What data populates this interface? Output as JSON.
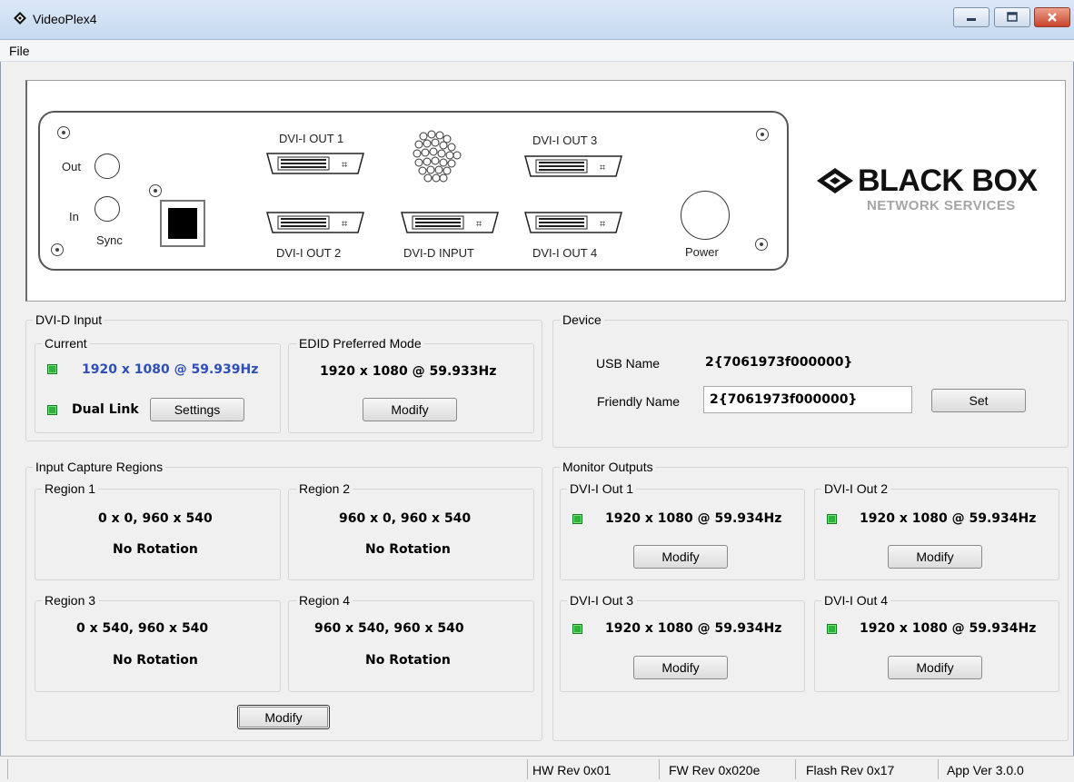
{
  "window": {
    "title": "VideoPlex4",
    "minimize_icon": "minimize-icon",
    "maximize_icon": "maximize-icon",
    "close_icon": "close-icon"
  },
  "menu": {
    "file": "File"
  },
  "device_panel": {
    "out_label": "Out",
    "in_label": "In",
    "sync_label": "Sync",
    "dvi_out1": "DVI-I OUT 1",
    "dvi_out2": "DVI-I OUT 2",
    "dvi_out3": "DVI-I OUT 3",
    "dvi_out4": "DVI-I OUT 4",
    "dvi_input": "DVI-D INPUT",
    "power": "Power",
    "logo_main": "BLACK BOX",
    "logo_sub": "NETWORK SERVICES"
  },
  "dvi_input_group": {
    "title": "DVI-D Input",
    "current": {
      "title": "Current",
      "resolution": "1920 x 1080 @ 59.939Hz",
      "dual_link": "Dual Link",
      "settings_button": "Settings"
    },
    "edid": {
      "title": "EDID Preferred Mode",
      "resolution": "1920 x 1080 @ 59.933Hz",
      "modify_button": "Modify"
    }
  },
  "device_group": {
    "title": "Device",
    "usb_name_label": "USB Name",
    "usb_name_value": "2{7061973f000000}",
    "friendly_name_label": "Friendly Name",
    "friendly_name_value": "2{7061973f000000}",
    "set_button": "Set"
  },
  "capture_group": {
    "title": "Input Capture Regions",
    "regions": [
      {
        "title": "Region 1",
        "geometry": "0 x 0, 960 x 540",
        "rotation": "No Rotation"
      },
      {
        "title": "Region 2",
        "geometry": "960 x 0, 960 x 540",
        "rotation": "No Rotation"
      },
      {
        "title": "Region 3",
        "geometry": "0 x 540, 960 x 540",
        "rotation": "No Rotation"
      },
      {
        "title": "Region 4",
        "geometry": "960 x 540, 960 x 540",
        "rotation": "No Rotation"
      }
    ],
    "modify_button": "Modify"
  },
  "monitor_group": {
    "title": "Monitor Outputs",
    "outputs": [
      {
        "title": "DVI-I Out 1",
        "resolution": "1920 x 1080 @ 59.934Hz",
        "modify_button": "Modify"
      },
      {
        "title": "DVI-I Out 2",
        "resolution": "1920 x 1080 @ 59.934Hz",
        "modify_button": "Modify"
      },
      {
        "title": "DVI-I Out 3",
        "resolution": "1920 x 1080 @ 59.934Hz",
        "modify_button": "Modify"
      },
      {
        "title": "DVI-I Out 4",
        "resolution": "1920 x 1080 @ 59.934Hz",
        "modify_button": "Modify"
      }
    ]
  },
  "status_bar": {
    "hw_rev": "HW Rev 0x01",
    "fw_rev": "FW Rev 0x020e",
    "flash_rev": "Flash Rev 0x17",
    "app_ver": "App Ver 3.0.0"
  },
  "colors": {
    "led_green": "#2db33a",
    "current_text_blue": "#2e4fb5"
  }
}
